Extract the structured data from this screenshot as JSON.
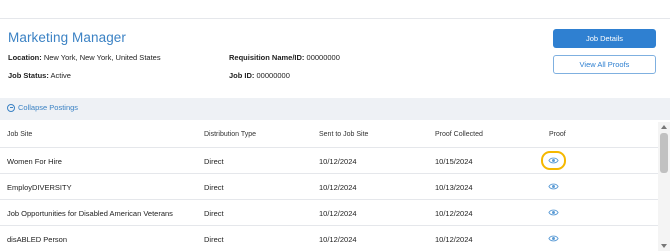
{
  "header": {
    "title": "Marketing Manager",
    "location_label": "Location:",
    "location_value": "New York, New York, United States",
    "status_label": "Job Status:",
    "status_value": "Active",
    "req_label": "Requisition Name/ID:",
    "req_value": "00000000",
    "jobid_label": "Job ID:",
    "jobid_value": "00000000",
    "job_details_button": "Job Details",
    "view_proofs_button": "View All Proofs"
  },
  "postings": {
    "collapse_label": "Collapse Postings",
    "columns": [
      "Job Site",
      "Distribution Type",
      "Sent to Job Site",
      "Proof Collected",
      "Proof"
    ],
    "rows": [
      {
        "site": "Women For Hire",
        "type": "Direct",
        "sent": "10/12/2024",
        "collected": "10/15/2024",
        "proof_icon": "eye-icon",
        "highlighted": true
      },
      {
        "site": "EmployDIVERSITY",
        "type": "Direct",
        "sent": "10/12/2024",
        "collected": "10/13/2024",
        "proof_icon": "eye-icon",
        "highlighted": false
      },
      {
        "site": "Job Opportunities for Disabled American Veterans",
        "type": "Direct",
        "sent": "10/12/2024",
        "collected": "10/12/2024",
        "proof_icon": "eye-icon",
        "highlighted": false
      },
      {
        "site": "disABLED Person",
        "type": "Direct",
        "sent": "10/12/2024",
        "collected": "10/12/2024",
        "proof_icon": "eye-icon",
        "highlighted": false
      }
    ]
  },
  "colors": {
    "accent": "#2f80d1",
    "title": "#3b82c4",
    "highlight": "#f5b800"
  }
}
